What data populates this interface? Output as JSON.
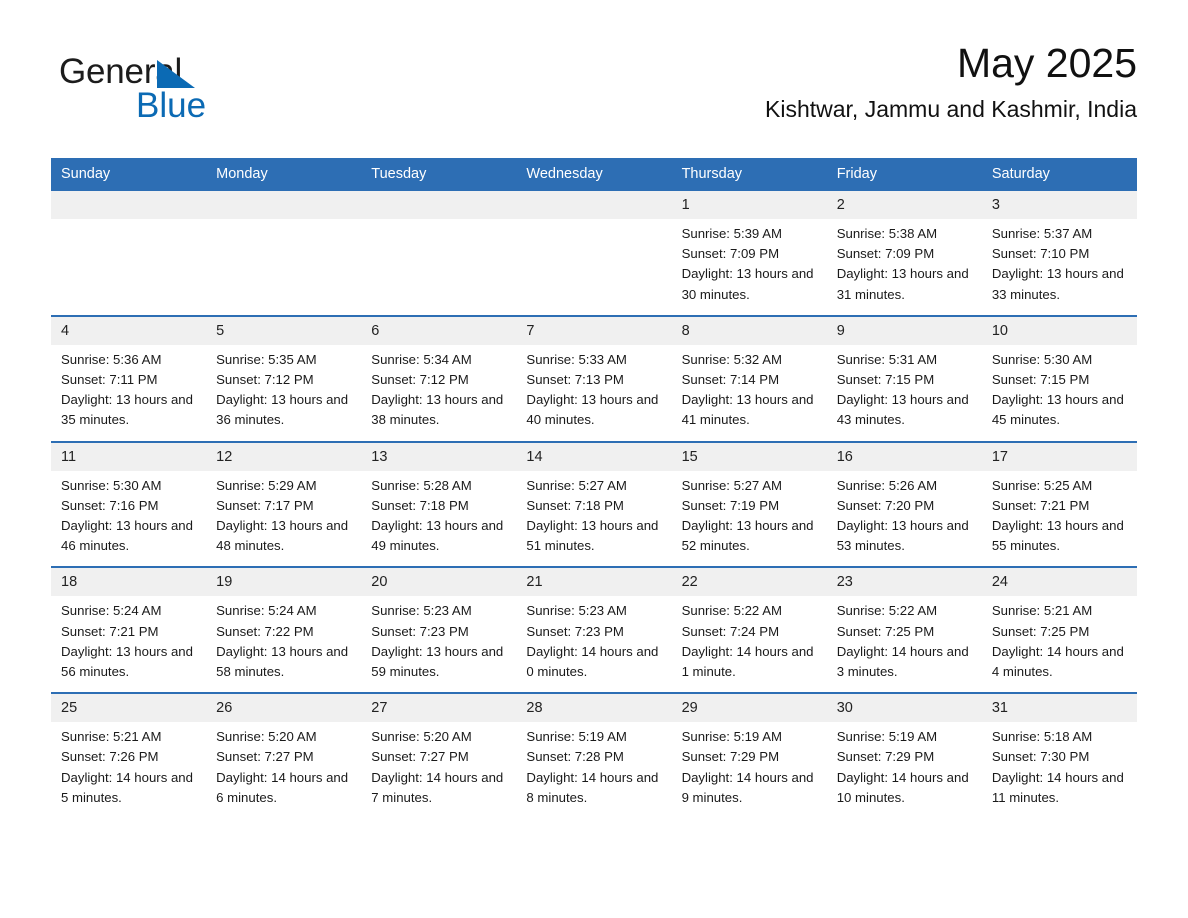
{
  "brand": {
    "name_part1": "General",
    "name_part2": "Blue",
    "accent_color": "#0b6ab4"
  },
  "header": {
    "title": "May 2025",
    "subtitle": "Kishtwar, Jammu and Kashmir, India"
  },
  "theme": {
    "header_blue": "#2d6eb4",
    "day_band_gray": "#f0f0f0"
  },
  "calendar": {
    "weekdays": [
      "Sunday",
      "Monday",
      "Tuesday",
      "Wednesday",
      "Thursday",
      "Friday",
      "Saturday"
    ],
    "weeks": [
      [
        {
          "day": "",
          "empty": true,
          "sunrise": "",
          "sunset": "",
          "daylight": ""
        },
        {
          "day": "",
          "empty": true,
          "sunrise": "",
          "sunset": "",
          "daylight": ""
        },
        {
          "day": "",
          "empty": true,
          "sunrise": "",
          "sunset": "",
          "daylight": ""
        },
        {
          "day": "",
          "empty": true,
          "sunrise": "",
          "sunset": "",
          "daylight": ""
        },
        {
          "day": "1",
          "sunrise": "Sunrise: 5:39 AM",
          "sunset": "Sunset: 7:09 PM",
          "daylight": "Daylight: 13 hours and 30 minutes."
        },
        {
          "day": "2",
          "sunrise": "Sunrise: 5:38 AM",
          "sunset": "Sunset: 7:09 PM",
          "daylight": "Daylight: 13 hours and 31 minutes."
        },
        {
          "day": "3",
          "sunrise": "Sunrise: 5:37 AM",
          "sunset": "Sunset: 7:10 PM",
          "daylight": "Daylight: 13 hours and 33 minutes."
        }
      ],
      [
        {
          "day": "4",
          "sunrise": "Sunrise: 5:36 AM",
          "sunset": "Sunset: 7:11 PM",
          "daylight": "Daylight: 13 hours and 35 minutes."
        },
        {
          "day": "5",
          "sunrise": "Sunrise: 5:35 AM",
          "sunset": "Sunset: 7:12 PM",
          "daylight": "Daylight: 13 hours and 36 minutes."
        },
        {
          "day": "6",
          "sunrise": "Sunrise: 5:34 AM",
          "sunset": "Sunset: 7:12 PM",
          "daylight": "Daylight: 13 hours and 38 minutes."
        },
        {
          "day": "7",
          "sunrise": "Sunrise: 5:33 AM",
          "sunset": "Sunset: 7:13 PM",
          "daylight": "Daylight: 13 hours and 40 minutes."
        },
        {
          "day": "8",
          "sunrise": "Sunrise: 5:32 AM",
          "sunset": "Sunset: 7:14 PM",
          "daylight": "Daylight: 13 hours and 41 minutes."
        },
        {
          "day": "9",
          "sunrise": "Sunrise: 5:31 AM",
          "sunset": "Sunset: 7:15 PM",
          "daylight": "Daylight: 13 hours and 43 minutes."
        },
        {
          "day": "10",
          "sunrise": "Sunrise: 5:30 AM",
          "sunset": "Sunset: 7:15 PM",
          "daylight": "Daylight: 13 hours and 45 minutes."
        }
      ],
      [
        {
          "day": "11",
          "sunrise": "Sunrise: 5:30 AM",
          "sunset": "Sunset: 7:16 PM",
          "daylight": "Daylight: 13 hours and 46 minutes."
        },
        {
          "day": "12",
          "sunrise": "Sunrise: 5:29 AM",
          "sunset": "Sunset: 7:17 PM",
          "daylight": "Daylight: 13 hours and 48 minutes."
        },
        {
          "day": "13",
          "sunrise": "Sunrise: 5:28 AM",
          "sunset": "Sunset: 7:18 PM",
          "daylight": "Daylight: 13 hours and 49 minutes."
        },
        {
          "day": "14",
          "sunrise": "Sunrise: 5:27 AM",
          "sunset": "Sunset: 7:18 PM",
          "daylight": "Daylight: 13 hours and 51 minutes."
        },
        {
          "day": "15",
          "sunrise": "Sunrise: 5:27 AM",
          "sunset": "Sunset: 7:19 PM",
          "daylight": "Daylight: 13 hours and 52 minutes."
        },
        {
          "day": "16",
          "sunrise": "Sunrise: 5:26 AM",
          "sunset": "Sunset: 7:20 PM",
          "daylight": "Daylight: 13 hours and 53 minutes."
        },
        {
          "day": "17",
          "sunrise": "Sunrise: 5:25 AM",
          "sunset": "Sunset: 7:21 PM",
          "daylight": "Daylight: 13 hours and 55 minutes."
        }
      ],
      [
        {
          "day": "18",
          "sunrise": "Sunrise: 5:24 AM",
          "sunset": "Sunset: 7:21 PM",
          "daylight": "Daylight: 13 hours and 56 minutes."
        },
        {
          "day": "19",
          "sunrise": "Sunrise: 5:24 AM",
          "sunset": "Sunset: 7:22 PM",
          "daylight": "Daylight: 13 hours and 58 minutes."
        },
        {
          "day": "20",
          "sunrise": "Sunrise: 5:23 AM",
          "sunset": "Sunset: 7:23 PM",
          "daylight": "Daylight: 13 hours and 59 minutes."
        },
        {
          "day": "21",
          "sunrise": "Sunrise: 5:23 AM",
          "sunset": "Sunset: 7:23 PM",
          "daylight": "Daylight: 14 hours and 0 minutes."
        },
        {
          "day": "22",
          "sunrise": "Sunrise: 5:22 AM",
          "sunset": "Sunset: 7:24 PM",
          "daylight": "Daylight: 14 hours and 1 minute."
        },
        {
          "day": "23",
          "sunrise": "Sunrise: 5:22 AM",
          "sunset": "Sunset: 7:25 PM",
          "daylight": "Daylight: 14 hours and 3 minutes."
        },
        {
          "day": "24",
          "sunrise": "Sunrise: 5:21 AM",
          "sunset": "Sunset: 7:25 PM",
          "daylight": "Daylight: 14 hours and 4 minutes."
        }
      ],
      [
        {
          "day": "25",
          "sunrise": "Sunrise: 5:21 AM",
          "sunset": "Sunset: 7:26 PM",
          "daylight": "Daylight: 14 hours and 5 minutes."
        },
        {
          "day": "26",
          "sunrise": "Sunrise: 5:20 AM",
          "sunset": "Sunset: 7:27 PM",
          "daylight": "Daylight: 14 hours and 6 minutes."
        },
        {
          "day": "27",
          "sunrise": "Sunrise: 5:20 AM",
          "sunset": "Sunset: 7:27 PM",
          "daylight": "Daylight: 14 hours and 7 minutes."
        },
        {
          "day": "28",
          "sunrise": "Sunrise: 5:19 AM",
          "sunset": "Sunset: 7:28 PM",
          "daylight": "Daylight: 14 hours and 8 minutes."
        },
        {
          "day": "29",
          "sunrise": "Sunrise: 5:19 AM",
          "sunset": "Sunset: 7:29 PM",
          "daylight": "Daylight: 14 hours and 9 minutes."
        },
        {
          "day": "30",
          "sunrise": "Sunrise: 5:19 AM",
          "sunset": "Sunset: 7:29 PM",
          "daylight": "Daylight: 14 hours and 10 minutes."
        },
        {
          "day": "31",
          "sunrise": "Sunrise: 5:18 AM",
          "sunset": "Sunset: 7:30 PM",
          "daylight": "Daylight: 14 hours and 11 minutes."
        }
      ]
    ]
  }
}
